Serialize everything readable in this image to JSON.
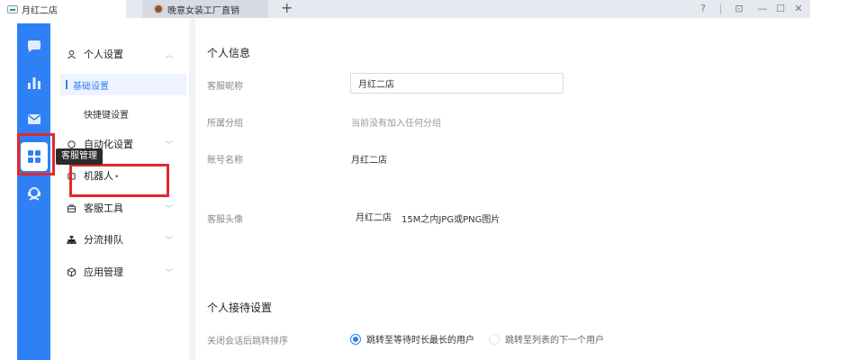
{
  "tabs": [
    {
      "label": "月红二店"
    },
    {
      "label": "晚意女装工厂直销"
    }
  ],
  "new_tab_symbol": "+",
  "window_controls": {
    "help": "?",
    "pin": "⊡",
    "minimize": "—",
    "maximize": "☐",
    "close": "✕"
  },
  "rail": {
    "items": [
      {
        "icon": "chat-bubble-icon"
      },
      {
        "icon": "bar-chart-icon"
      },
      {
        "icon": "mail-icon"
      },
      {
        "icon": "grid-apps-icon",
        "selected": true
      },
      {
        "icon": "agent-headset-icon"
      }
    ],
    "tooltip": "客服管理",
    "accent": "#2f80f5"
  },
  "submenu": {
    "personal": "个人设置",
    "basic": "基础设置",
    "shortcuts": "快捷键设置",
    "automation": "自动化设置",
    "robot": "机器人",
    "robot_badge": "•",
    "tools": "客服工具",
    "routing": "分流排队",
    "apps": "应用管理"
  },
  "main": {
    "personal_info_title": "个人信息",
    "nickname_label": "客服昵称",
    "nickname_value": "月红二店",
    "group_label": "所属分组",
    "group_value": "当前没有加入任何分组",
    "account_label": "账号名称",
    "account_value": "月红二店",
    "avatar_label": "客服头像",
    "avatar_name": "月红二店",
    "avatar_hint": "15M之内JPG或PNG图片",
    "reception_title": "个人接待设置",
    "after_close_label": "关闭会话后跳转排序",
    "option_longest": "跳转至等待时长最长的用户",
    "option_next": "跳转至列表的下一个用户"
  },
  "highlight_color": "#e3282d"
}
